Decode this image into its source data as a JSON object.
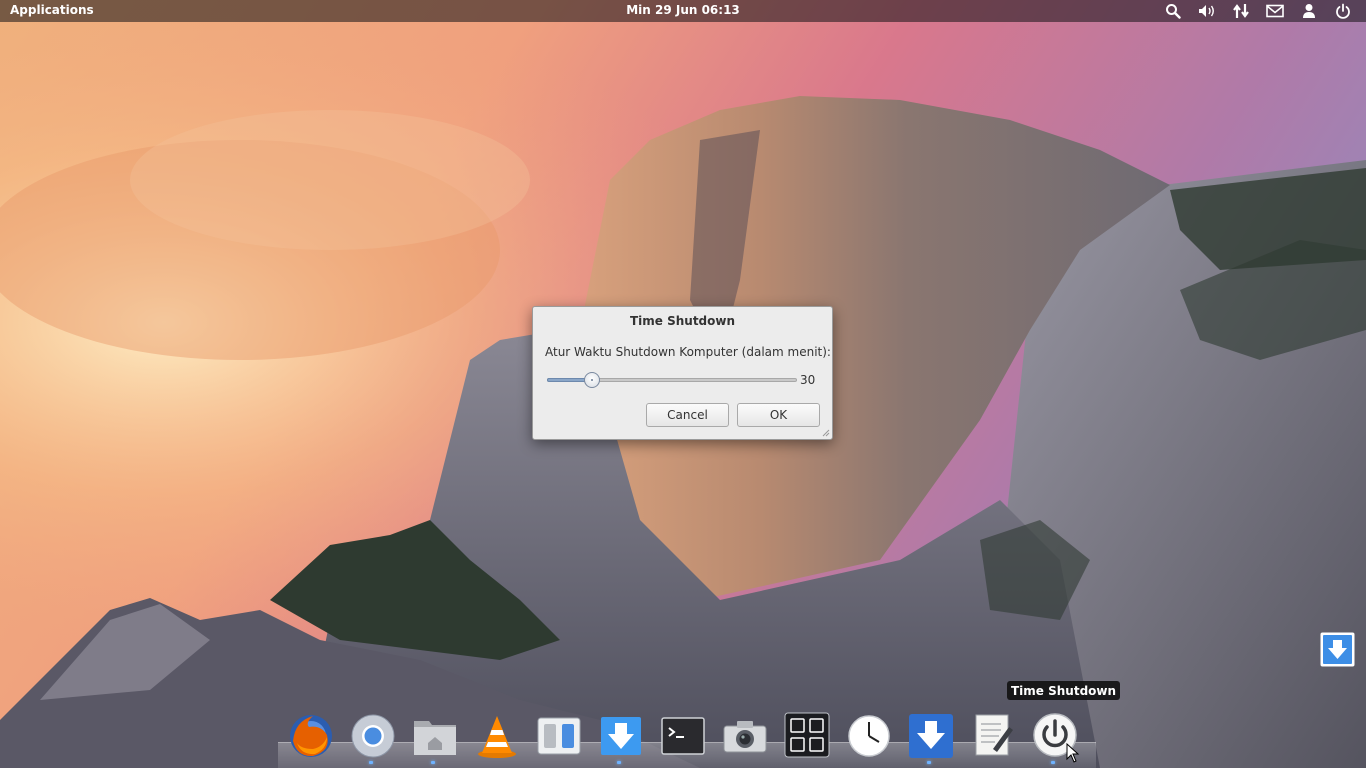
{
  "top_panel": {
    "applications_label": "Applications",
    "clock": "Min 29 Jun 06:13",
    "indicators": [
      "search-icon",
      "volume-icon",
      "network-icon",
      "mail-icon",
      "user-icon",
      "power-icon"
    ]
  },
  "dialog": {
    "title": "Time Shutdown",
    "label": "Atur Waktu Shutdown Komputer (dalam menit):",
    "slider_value": "30",
    "slider_fraction": 0.18,
    "cancel_label": "Cancel",
    "ok_label": "OK"
  },
  "tooltip": {
    "text": "Time Shutdown"
  },
  "dock": {
    "items": [
      "firefox-icon",
      "chromium-icon",
      "home-folder-icon",
      "vlc-icon",
      "switchboard-icon",
      "download-icon",
      "terminal-icon",
      "camera-icon",
      "system-monitor-icon",
      "clock-icon",
      "download-manager-icon",
      "text-editor-icon",
      "time-shutdown-icon"
    ]
  },
  "colors": {
    "panel_bg": "#141216",
    "dialog_bg": "#ececec",
    "accent_blue": "#3d8ee6",
    "indicator_dot": "#6fb3ff"
  }
}
